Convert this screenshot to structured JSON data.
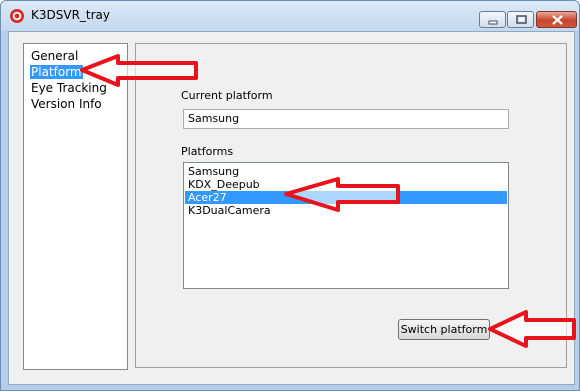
{
  "window": {
    "title": "K3DSVR_tray",
    "controls": [
      "minimize",
      "maximize",
      "close"
    ]
  },
  "sidebar": {
    "items": [
      {
        "label": "General",
        "selected": false
      },
      {
        "label": "Platform",
        "selected": true
      },
      {
        "label": "Eye Tracking",
        "selected": false
      },
      {
        "label": "Version Info",
        "selected": false
      }
    ]
  },
  "platform_page": {
    "current_platform_label": "Current platform",
    "current_platform_value": "Samsung",
    "platforms_label": "Platforms",
    "platforms": [
      {
        "name": "Samsung",
        "selected": false
      },
      {
        "name": "KDX_Deepub",
        "selected": false
      },
      {
        "name": "Acer27",
        "selected": true
      },
      {
        "name": "K3DualCamera",
        "selected": false
      }
    ],
    "switch_button_label": "Switch platform"
  },
  "annotations": {
    "arrow_color": "#e8141c",
    "arrows": [
      "arrow pointing at Platform tab",
      "arrow pointing at Acer27 entry",
      "arrow pointing at Switch platform button"
    ]
  },
  "colors": {
    "selection": "#3399ff",
    "client_background": "#f0f0f0"
  }
}
